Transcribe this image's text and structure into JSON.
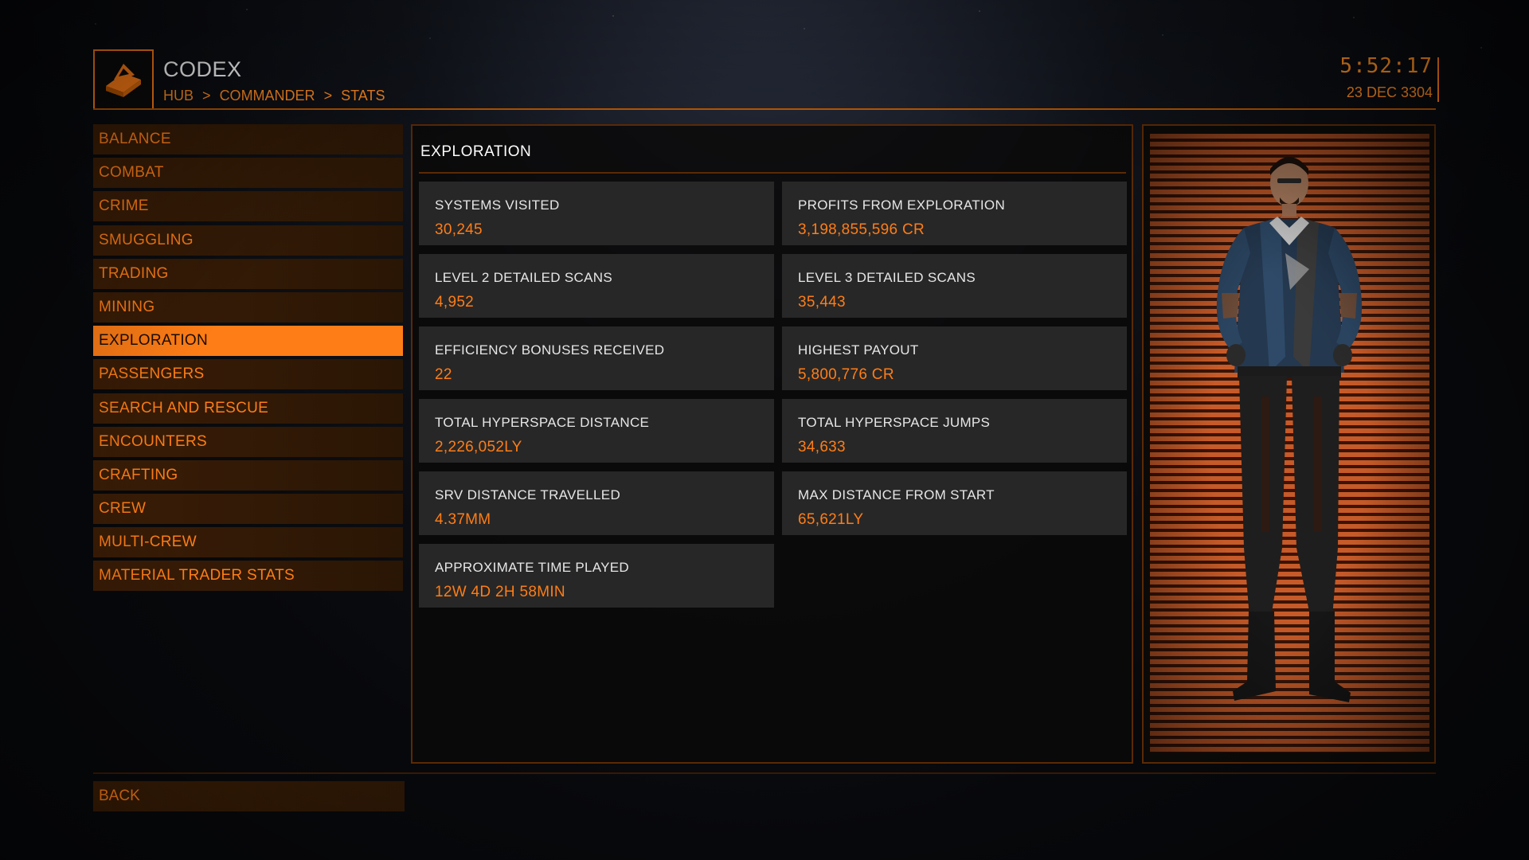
{
  "header": {
    "title": "CODEX",
    "breadcrumb": [
      "HUB",
      ">",
      "COMMANDER",
      ">",
      "STATS"
    ],
    "time": "5:52:17",
    "date": "23 DEC 3304",
    "icon": "codex-book-icon"
  },
  "nav": {
    "items": [
      {
        "label": "BALANCE"
      },
      {
        "label": "COMBAT"
      },
      {
        "label": "CRIME"
      },
      {
        "label": "SMUGGLING"
      },
      {
        "label": "TRADING"
      },
      {
        "label": "MINING"
      },
      {
        "label": "EXPLORATION",
        "active": true
      },
      {
        "label": "PASSENGERS"
      },
      {
        "label": "SEARCH AND RESCUE"
      },
      {
        "label": "ENCOUNTERS"
      },
      {
        "label": "CRAFTING"
      },
      {
        "label": "CREW"
      },
      {
        "label": "MULTI-CREW"
      },
      {
        "label": "MATERIAL TRADER STATS"
      }
    ]
  },
  "main": {
    "title": "EXPLORATION",
    "stats": [
      {
        "label": "SYSTEMS VISITED",
        "value": "30,245"
      },
      {
        "label": "PROFITS FROM EXPLORATION",
        "value": "3,198,855,596 CR"
      },
      {
        "label": "LEVEL 2 DETAILED SCANS",
        "value": "4,952"
      },
      {
        "label": "LEVEL 3 DETAILED SCANS",
        "value": "35,443"
      },
      {
        "label": "EFFICIENCY BONUSES RECEIVED",
        "value": "22"
      },
      {
        "label": "HIGHEST PAYOUT",
        "value": "5,800,776 CR"
      },
      {
        "label": "TOTAL HYPERSPACE DISTANCE",
        "value": "2,226,052LY"
      },
      {
        "label": "TOTAL HYPERSPACE JUMPS",
        "value": "34,633"
      },
      {
        "label": "SRV DISTANCE TRAVELLED",
        "value": "4.37MM"
      },
      {
        "label": "MAX DISTANCE FROM START",
        "value": "65,621LY"
      },
      {
        "label": "APPROXIMATE TIME PLAYED",
        "value": "12W 4D 2H 58MIN"
      }
    ]
  },
  "footer": {
    "back_label": "BACK"
  },
  "colors": {
    "accent": "#ff7d16",
    "card_bg": "#272727",
    "nav_bg": "#2f1805"
  }
}
